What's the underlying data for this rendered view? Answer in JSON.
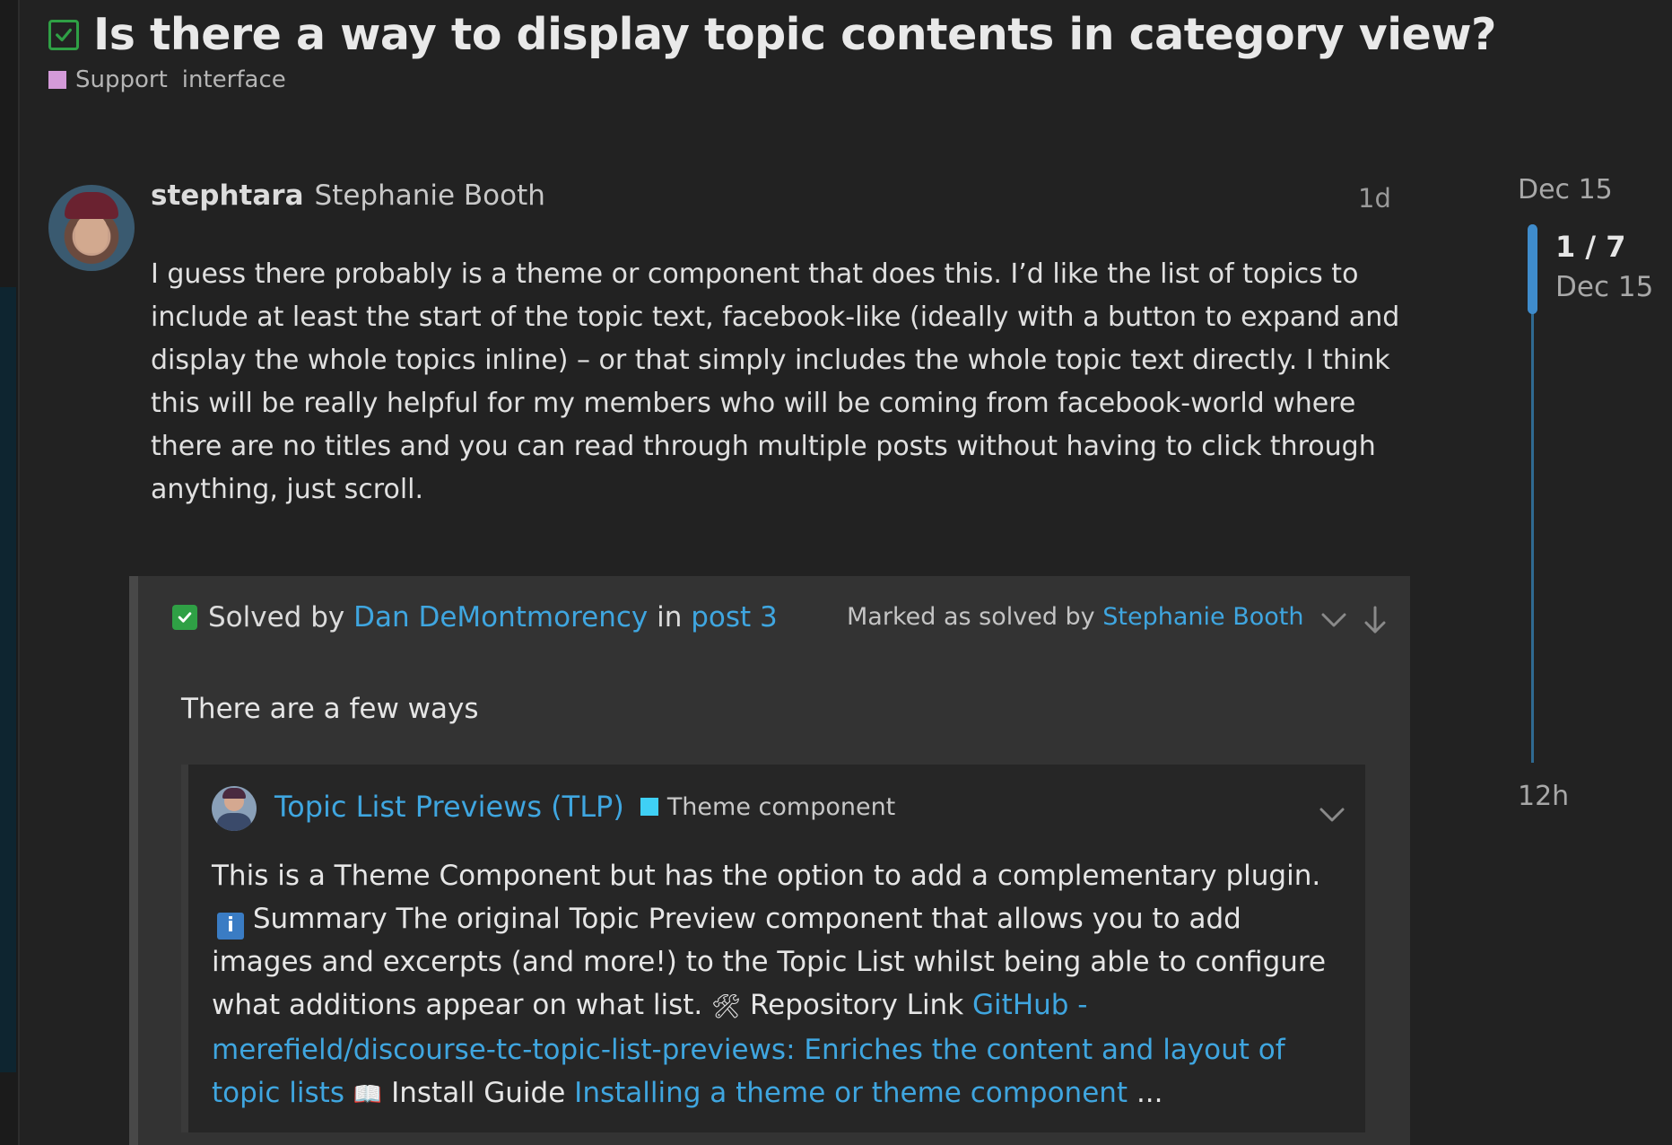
{
  "topic": {
    "title": "Is there a way to display topic contents in category view?",
    "category": "Support",
    "tag": "interface",
    "category_color": "#d49ad9"
  },
  "post": {
    "username": "stephtara",
    "full_name": "Stephanie Booth",
    "age": "1d",
    "body": "I guess there probably is a theme or component that does this. I’d like the list of topics to include at least the start of the topic text, facebook-like (ideally with a button to expand and display the whole topics inline) – or that simply includes the whole topic text directly. I think this will be really helpful for my members who will be coming from facebook-world where there are no titles and you can read through multiple posts without having to click through anything, just scroll."
  },
  "solution": {
    "solved_by_prefix": "Solved by",
    "solver": "Dan DeMontmorency",
    "in_word": "in",
    "post_link": "post 3",
    "marked_prefix": "Marked as solved by",
    "marked_by": "Stephanie Booth",
    "answer_text": "There are a few ways",
    "onebox": {
      "title": "Topic List Previews (TLP)",
      "category": "Theme component",
      "category_color": "#3fd0f5",
      "info_badge": "i",
      "text_part1": "This is a Theme Component but has the option to add a complementary plugin.",
      "text_part2": "Summary The original Topic Preview component that allows you to add images and excerpts (and more!) to the Topic List whilst being able to configure what additions appear on what list.",
      "tools_emoji": "🛠",
      "repo_label": "Repository Link",
      "repo_link": "GitHub - merefield/discourse-tc-topic-list-previews: Enriches the content and layout of topic lists",
      "book_emoji": "📖",
      "guide_label": "Install Guide",
      "guide_link": "Installing a theme or theme component",
      "ellipsis": "..."
    }
  },
  "timeline": {
    "start_date": "Dec 15",
    "counter": "1 / 7",
    "current_date": "Dec 15",
    "end_label": "12h"
  },
  "colors": {
    "background": "#222222",
    "link": "#3fa6e0",
    "solved_green": "#2fa045",
    "timeline_blue": "#3f8ccc"
  },
  "icons": {
    "title_status": "square-check-icon",
    "solved": "check-square-icon",
    "expand": "chevron-down-icon",
    "jump": "arrow-down-icon"
  }
}
